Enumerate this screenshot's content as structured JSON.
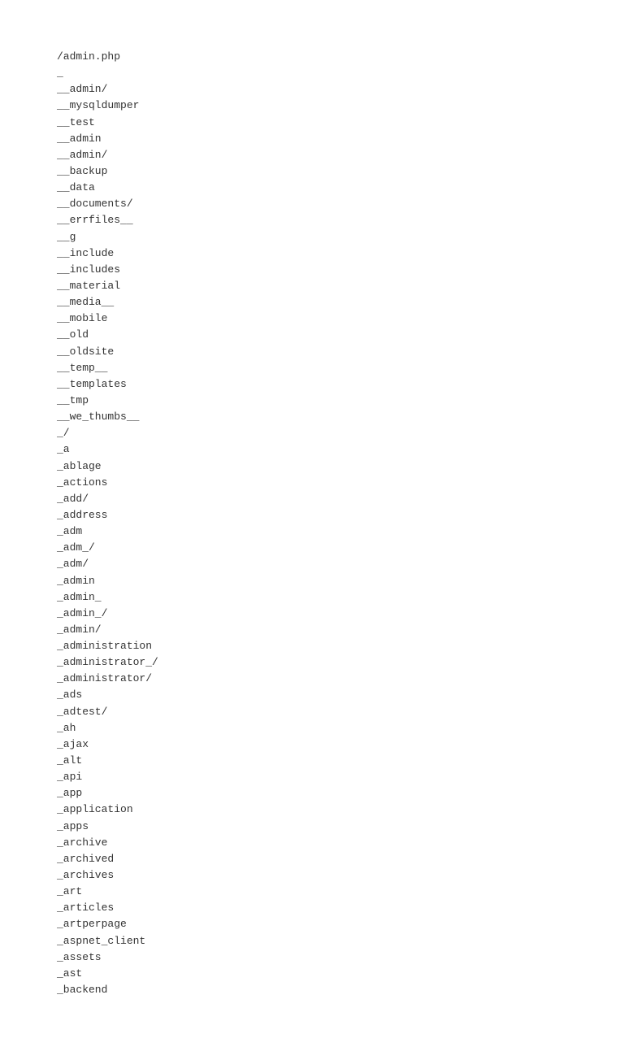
{
  "filelist": {
    "items": [
      "/admin.php",
      "_",
      "__admin/",
      "__mysqldumper",
      "__test",
      "__admin",
      "__admin/",
      "__backup",
      "__data",
      "__documents/",
      "__errfiles__",
      "__g",
      "__include",
      "__includes",
      "__material",
      "__media__",
      "__mobile",
      "__old",
      "__oldsite",
      "__temp__",
      "__templates",
      "__tmp",
      "__we_thumbs__",
      "_/",
      "_a",
      "_ablage",
      "_actions",
      "_add/",
      "_address",
      "_adm",
      "_adm_/",
      "_adm/",
      "_admin",
      "_admin_",
      "_admin_/",
      "_admin/",
      "_administration",
      "_administrator_/",
      "_administrator/",
      "_ads",
      "_adtest/",
      "_ah",
      "_ajax",
      "_alt",
      "_api",
      "_app",
      "_application",
      "_apps",
      "_archive",
      "_archived",
      "_archives",
      "_art",
      "_articles",
      "_artperpage",
      "_aspnet_client",
      "_assets",
      "_ast",
      "_backend"
    ]
  }
}
